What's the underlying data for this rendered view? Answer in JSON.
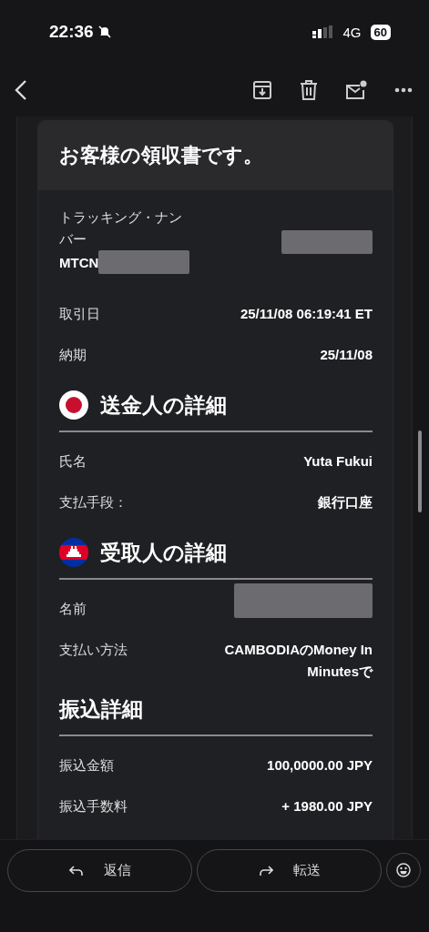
{
  "status_bar": {
    "time": "22:36",
    "network": "4G",
    "battery": "60"
  },
  "card": {
    "title": "お客様の領収書です。",
    "sections": [
      {
        "rows": [
          {
            "kind": "tracking",
            "label": "トラッキング・ナンバー",
            "code": "MTCN",
            "redacted": true
          },
          {
            "kind": "plain",
            "label": "取引日",
            "value": "25/11/08 06:19:41 ET",
            "redacted": false
          },
          {
            "kind": "plain",
            "label": "納期",
            "value": "25/11/08",
            "redacted": false
          }
        ]
      },
      {
        "title": "送金人の詳細",
        "kind": "japan",
        "rows": [
          {
            "kind": "plain",
            "label": "氏名",
            "value": "Yuta Fukui",
            "redacted": false
          },
          {
            "kind": "plain",
            "label": "支払手段：",
            "value": "銀行口座",
            "redacted": false
          }
        ]
      },
      {
        "title": "受取人の詳細",
        "kind": "cambodia",
        "rows": [
          {
            "kind": "plain",
            "label": "名前",
            "redacted": true
          },
          {
            "kind": "plain",
            "label": "支払い方法",
            "value": "CAMBODIAのMoney In Minutesで",
            "redacted": false
          }
        ]
      },
      {
        "title": "振込詳細",
        "kind": "plain",
        "rows": [
          {
            "kind": "plain",
            "label": "振込金額",
            "value": "100,0000.00 JPY",
            "redacted": false
          },
          {
            "kind": "plain",
            "label": "振込手数料",
            "value": "+ 1980.00 JPY",
            "redacted": false
          }
        ]
      }
    ]
  },
  "actions": [
    {
      "kind": "reply",
      "label": "返信"
    },
    {
      "kind": "forward",
      "label": "転送"
    }
  ]
}
